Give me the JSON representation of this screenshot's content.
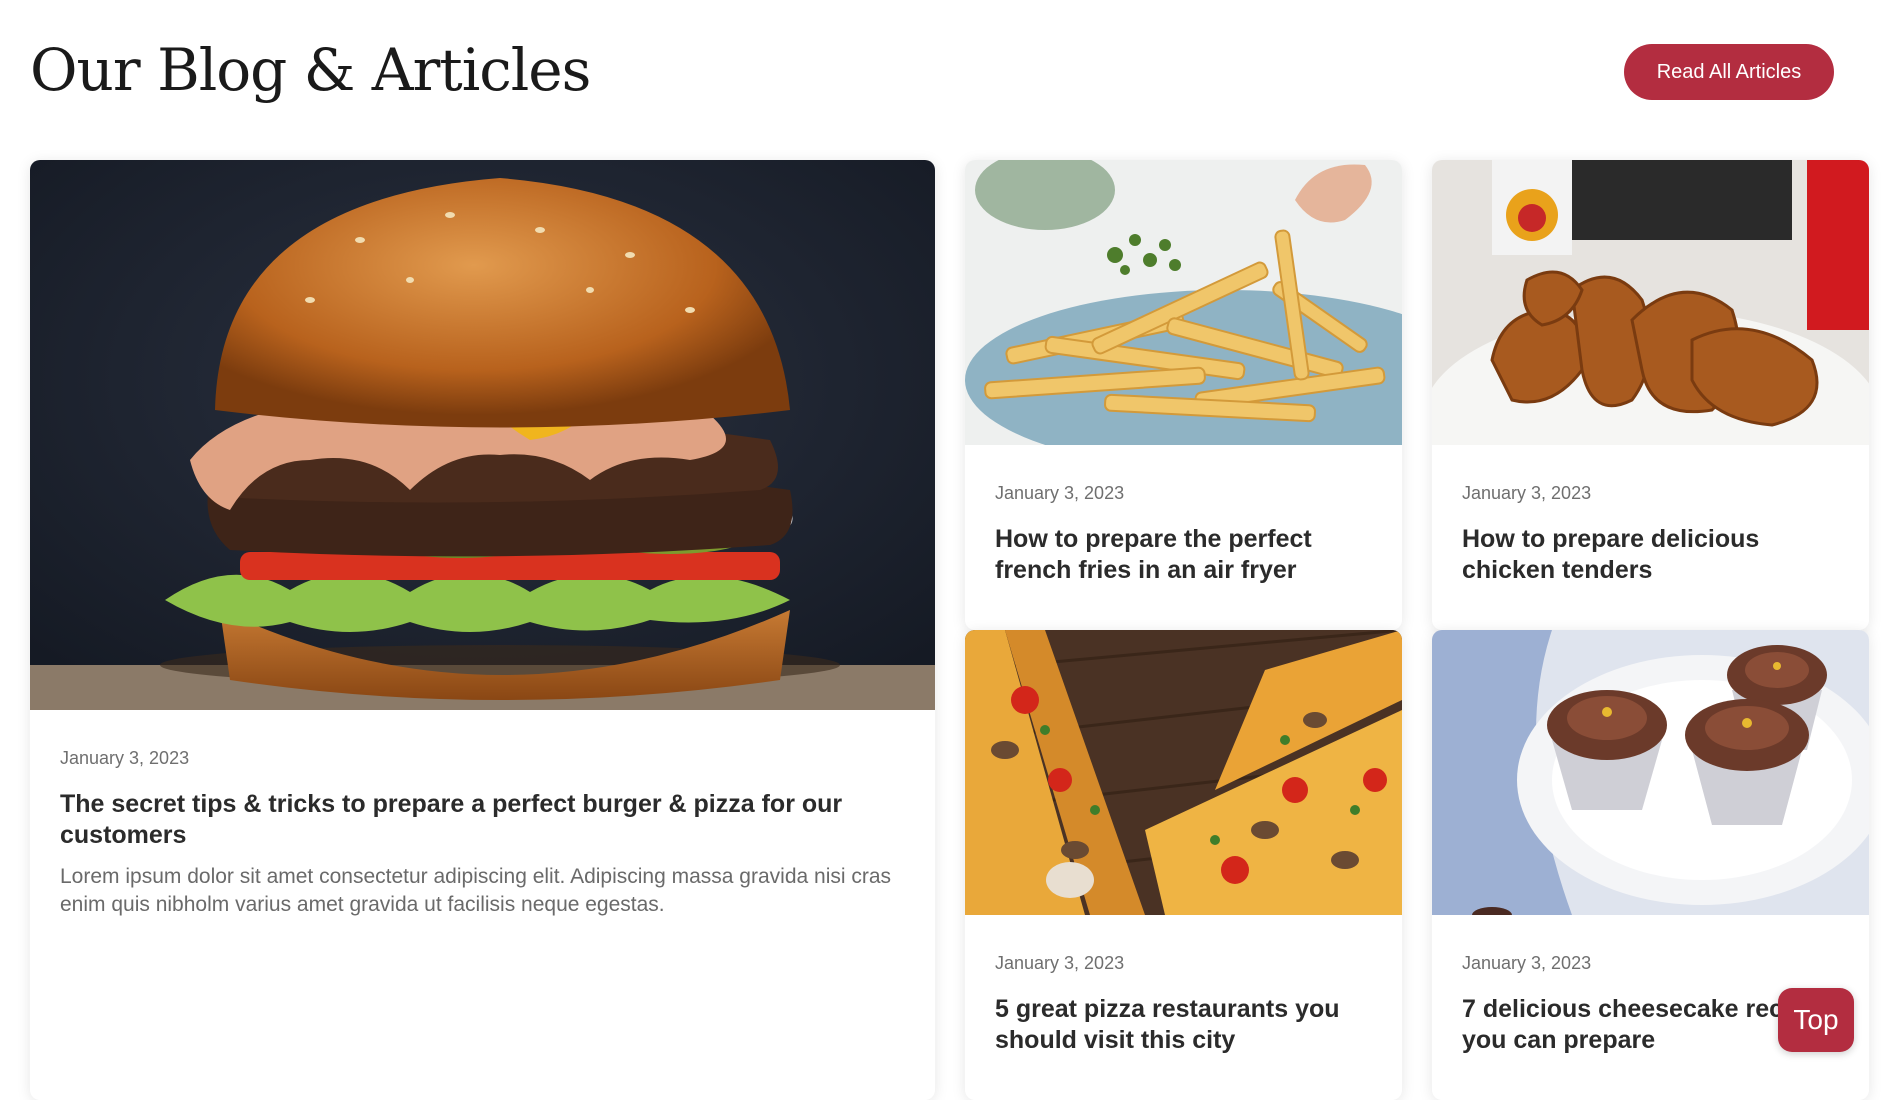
{
  "header": {
    "title": "Our Blog & Articles",
    "cta_label": "Read All Articles"
  },
  "featured": {
    "date": "January 3, 2023",
    "title": "The secret tips & tricks to prepare a perfect burger & pizza for our customers",
    "excerpt": "Lorem ipsum dolor sit amet consectetur adipiscing elit. Adipiscing massa gravida nisi cras enim quis nibholm varius amet gravida ut facilisis neque egestas."
  },
  "articles": [
    {
      "date": "January 3, 2023",
      "title": "How to prepare the perfect french fries in an air fryer"
    },
    {
      "date": "January 3, 2023",
      "title": "How to prepare delicious chicken tenders"
    },
    {
      "date": "January 3, 2023",
      "title": "5 great pizza restaurants you should visit this city"
    },
    {
      "date": "January 3, 2023",
      "title": "7 delicious cheesecake recipes you can prepare"
    }
  ],
  "top_button": {
    "label": "Top"
  },
  "colors": {
    "accent": "#b32d40",
    "text": "#2b2b2b",
    "muted": "#6f6f6f"
  }
}
